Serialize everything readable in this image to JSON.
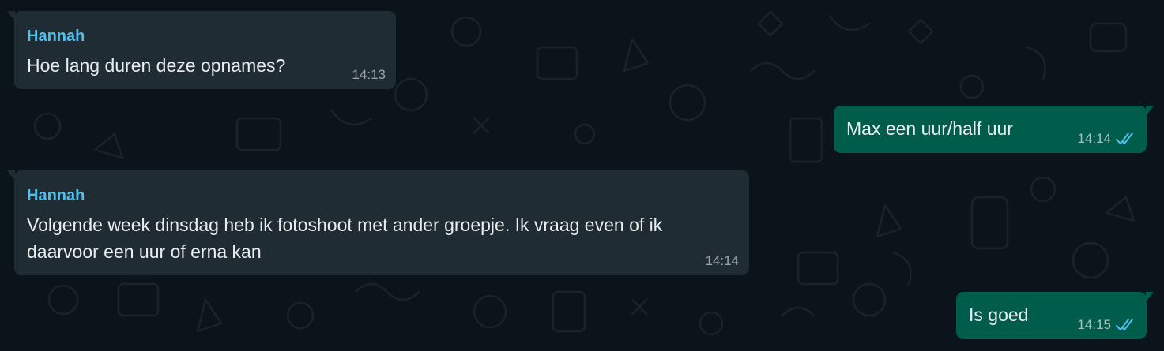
{
  "colors": {
    "background": "#0b141a",
    "incoming_bubble": "#202c33",
    "outgoing_bubble": "#005c4b",
    "sender_name": "#53bdeb",
    "read_ticks": "#53bdeb"
  },
  "messages": [
    {
      "direction": "incoming",
      "sender": "Hannah",
      "text": "Hoe lang duren deze opnames?",
      "time": "14:13"
    },
    {
      "direction": "outgoing",
      "text": "Max een uur/half uur",
      "time": "14:14",
      "status_icon": "double-check-read-icon"
    },
    {
      "direction": "incoming",
      "sender": "Hannah",
      "text": "Volgende week dinsdag heb ik fotoshoot met ander groepje. Ik vraag even of ik\ndaarvoor een uur of erna kan",
      "time": "14:14"
    },
    {
      "direction": "outgoing",
      "text": "Is goed",
      "time": "14:15",
      "status_icon": "double-check-read-icon"
    }
  ]
}
